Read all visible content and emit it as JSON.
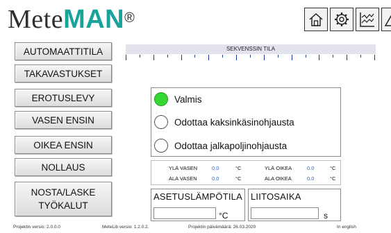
{
  "logo": {
    "prefix": "Mete",
    "accent": "MAN",
    "registered": "®"
  },
  "top_icons": [
    "home-icon",
    "gear-icon",
    "chart-icon",
    "warning-icon"
  ],
  "menu": [
    {
      "id": "automaattitila",
      "label": "AUTOMAATTITILA"
    },
    {
      "id": "takavastukset",
      "label": "TAKAVASTUKSET"
    },
    {
      "id": "erotuslevy",
      "label": "EROTUSLEVY"
    },
    {
      "id": "vasen-ensin",
      "label": "VASEN ENSIN"
    },
    {
      "id": "oikea-ensin",
      "label": "OIKEA ENSIN"
    },
    {
      "id": "nollaus",
      "label": "NOLLAUS"
    },
    {
      "id": "nosta-laske",
      "label": "NOSTA/LASKE\nTYÖKALUT"
    }
  ],
  "sequence": {
    "title": "SEKVENSSIN TILA"
  },
  "status": [
    {
      "label": "Valmis",
      "active": true
    },
    {
      "label": "Odottaa kaksinkäsinohjausta",
      "active": false
    },
    {
      "label": "Odottaa jalkapoljinohjausta",
      "active": false
    }
  ],
  "temps": {
    "yla_vasen": {
      "label": "YLÄ VASEN",
      "value": "0.0",
      "unit": "°C"
    },
    "yla_oikea": {
      "label": "YLÄ OIKEA",
      "value": "0.0",
      "unit": "°C"
    },
    "ala_vasen": {
      "label": "ALA VASEN",
      "value": "0.0",
      "unit": "°C"
    },
    "ala_oikea": {
      "label": "ALA OIKEA",
      "value": "0.0",
      "unit": "°C"
    }
  },
  "setpoint": {
    "title": "ASETUSLÄMPÖTILA",
    "value": "",
    "unit": "°C"
  },
  "joint_time": {
    "title": "LIITOSAIKA",
    "value": "",
    "unit": "s"
  },
  "footer": {
    "project_version": "Projektin versio: 2.0.0.0",
    "metelib_version": "MeteLib versio: 1.2.0.2.",
    "project_date": "Projektin päivämäärä: 26.03.2020",
    "language": "In english"
  },
  "colors": {
    "accent": "#1aa39a",
    "active": "#33d633",
    "value": "#2d63c8",
    "tick": "#1f3fa0"
  }
}
